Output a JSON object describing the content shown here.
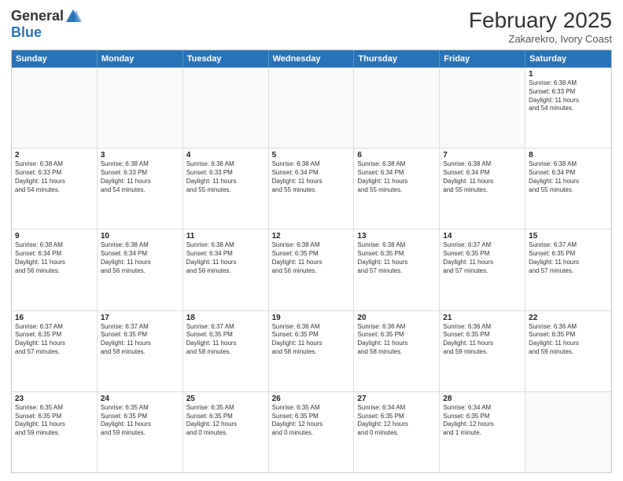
{
  "header": {
    "logo_general": "General",
    "logo_blue": "Blue",
    "month_year": "February 2025",
    "location": "Zakarekro, Ivory Coast"
  },
  "weekdays": [
    "Sunday",
    "Monday",
    "Tuesday",
    "Wednesday",
    "Thursday",
    "Friday",
    "Saturday"
  ],
  "rows": [
    [
      {
        "day": "",
        "info": "",
        "empty": true
      },
      {
        "day": "",
        "info": "",
        "empty": true
      },
      {
        "day": "",
        "info": "",
        "empty": true
      },
      {
        "day": "",
        "info": "",
        "empty": true
      },
      {
        "day": "",
        "info": "",
        "empty": true
      },
      {
        "day": "",
        "info": "",
        "empty": true
      },
      {
        "day": "1",
        "info": "Sunrise: 6:38 AM\nSunset: 6:33 PM\nDaylight: 11 hours\nand 54 minutes.",
        "empty": false
      }
    ],
    [
      {
        "day": "2",
        "info": "Sunrise: 6:38 AM\nSunset: 6:33 PM\nDaylight: 11 hours\nand 54 minutes.",
        "empty": false
      },
      {
        "day": "3",
        "info": "Sunrise: 6:38 AM\nSunset: 6:33 PM\nDaylight: 11 hours\nand 54 minutes.",
        "empty": false
      },
      {
        "day": "4",
        "info": "Sunrise: 6:38 AM\nSunset: 6:33 PM\nDaylight: 11 hours\nand 55 minutes.",
        "empty": false
      },
      {
        "day": "5",
        "info": "Sunrise: 6:38 AM\nSunset: 6:34 PM\nDaylight: 11 hours\nand 55 minutes.",
        "empty": false
      },
      {
        "day": "6",
        "info": "Sunrise: 6:38 AM\nSunset: 6:34 PM\nDaylight: 11 hours\nand 55 minutes.",
        "empty": false
      },
      {
        "day": "7",
        "info": "Sunrise: 6:38 AM\nSunset: 6:34 PM\nDaylight: 11 hours\nand 55 minutes.",
        "empty": false
      },
      {
        "day": "8",
        "info": "Sunrise: 6:38 AM\nSunset: 6:34 PM\nDaylight: 11 hours\nand 55 minutes.",
        "empty": false
      }
    ],
    [
      {
        "day": "9",
        "info": "Sunrise: 6:38 AM\nSunset: 6:34 PM\nDaylight: 11 hours\nand 56 minutes.",
        "empty": false
      },
      {
        "day": "10",
        "info": "Sunrise: 6:38 AM\nSunset: 6:34 PM\nDaylight: 11 hours\nand 56 minutes.",
        "empty": false
      },
      {
        "day": "11",
        "info": "Sunrise: 6:38 AM\nSunset: 6:34 PM\nDaylight: 11 hours\nand 56 minutes.",
        "empty": false
      },
      {
        "day": "12",
        "info": "Sunrise: 6:38 AM\nSunset: 6:35 PM\nDaylight: 11 hours\nand 56 minutes.",
        "empty": false
      },
      {
        "day": "13",
        "info": "Sunrise: 6:38 AM\nSunset: 6:35 PM\nDaylight: 11 hours\nand 57 minutes.",
        "empty": false
      },
      {
        "day": "14",
        "info": "Sunrise: 6:37 AM\nSunset: 6:35 PM\nDaylight: 11 hours\nand 57 minutes.",
        "empty": false
      },
      {
        "day": "15",
        "info": "Sunrise: 6:37 AM\nSunset: 6:35 PM\nDaylight: 11 hours\nand 57 minutes.",
        "empty": false
      }
    ],
    [
      {
        "day": "16",
        "info": "Sunrise: 6:37 AM\nSunset: 6:35 PM\nDaylight: 11 hours\nand 57 minutes.",
        "empty": false
      },
      {
        "day": "17",
        "info": "Sunrise: 6:37 AM\nSunset: 6:35 PM\nDaylight: 11 hours\nand 58 minutes.",
        "empty": false
      },
      {
        "day": "18",
        "info": "Sunrise: 6:37 AM\nSunset: 6:35 PM\nDaylight: 11 hours\nand 58 minutes.",
        "empty": false
      },
      {
        "day": "19",
        "info": "Sunrise: 6:36 AM\nSunset: 6:35 PM\nDaylight: 11 hours\nand 58 minutes.",
        "empty": false
      },
      {
        "day": "20",
        "info": "Sunrise: 6:36 AM\nSunset: 6:35 PM\nDaylight: 11 hours\nand 58 minutes.",
        "empty": false
      },
      {
        "day": "21",
        "info": "Sunrise: 6:36 AM\nSunset: 6:35 PM\nDaylight: 11 hours\nand 59 minutes.",
        "empty": false
      },
      {
        "day": "22",
        "info": "Sunrise: 6:36 AM\nSunset: 6:35 PM\nDaylight: 11 hours\nand 59 minutes.",
        "empty": false
      }
    ],
    [
      {
        "day": "23",
        "info": "Sunrise: 6:35 AM\nSunset: 6:35 PM\nDaylight: 11 hours\nand 59 minutes.",
        "empty": false
      },
      {
        "day": "24",
        "info": "Sunrise: 6:35 AM\nSunset: 6:35 PM\nDaylight: 11 hours\nand 59 minutes.",
        "empty": false
      },
      {
        "day": "25",
        "info": "Sunrise: 6:35 AM\nSunset: 6:35 PM\nDaylight: 12 hours\nand 0 minutes.",
        "empty": false
      },
      {
        "day": "26",
        "info": "Sunrise: 6:35 AM\nSunset: 6:35 PM\nDaylight: 12 hours\nand 0 minutes.",
        "empty": false
      },
      {
        "day": "27",
        "info": "Sunrise: 6:34 AM\nSunset: 6:35 PM\nDaylight: 12 hours\nand 0 minutes.",
        "empty": false
      },
      {
        "day": "28",
        "info": "Sunrise: 6:34 AM\nSunset: 6:35 PM\nDaylight: 12 hours\nand 1 minute.",
        "empty": false
      },
      {
        "day": "",
        "info": "",
        "empty": true
      }
    ]
  ]
}
